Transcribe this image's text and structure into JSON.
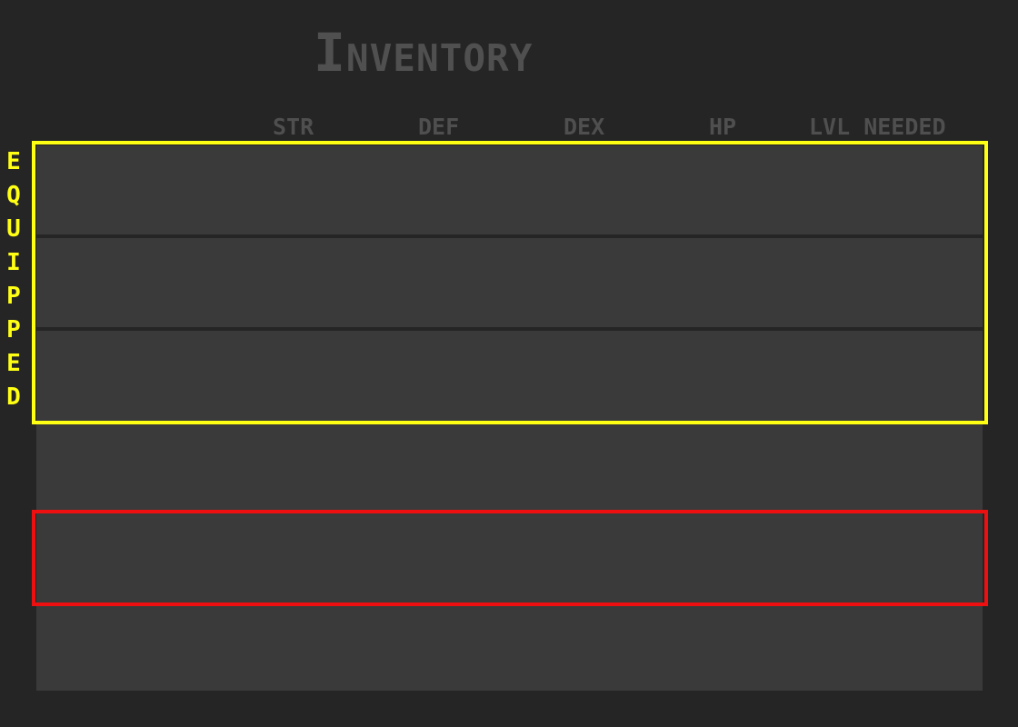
{
  "title": "Inventory",
  "columns": [
    "STR",
    "DEF",
    "DEX",
    "HP",
    "LVL NEEDED"
  ],
  "equipped_label": [
    "E",
    "Q",
    "U",
    "I",
    "P",
    "P",
    "E",
    "D"
  ],
  "colors": {
    "background": "#252525",
    "panel": "#3a3a3a",
    "header_text": "#4f4f4f",
    "equipped_highlight": "#ffff14",
    "selection_cursor": "#ee1010"
  }
}
